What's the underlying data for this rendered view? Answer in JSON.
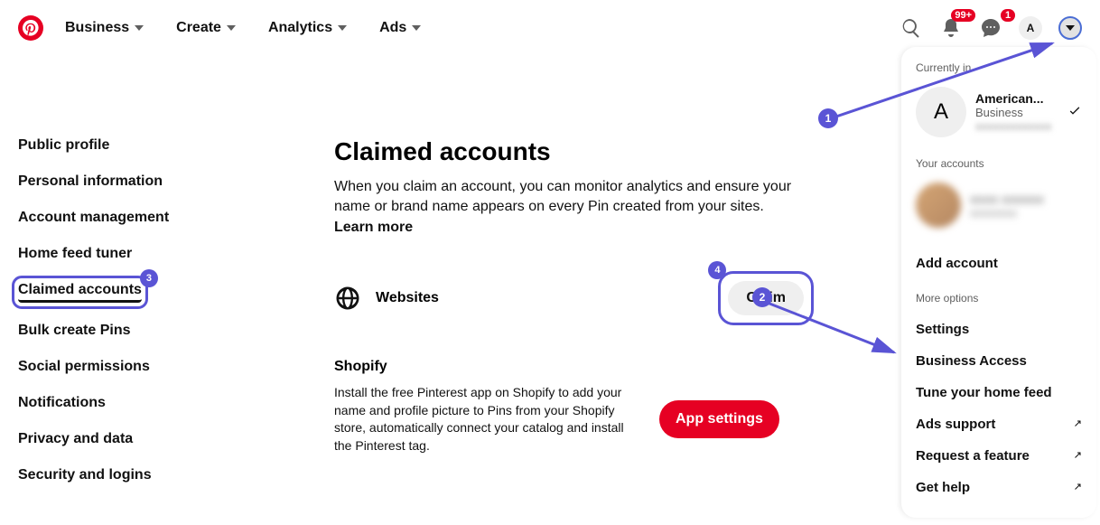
{
  "header": {
    "nav": [
      "Business",
      "Create",
      "Analytics",
      "Ads"
    ],
    "notif_badge": "99+",
    "msg_badge": "1",
    "avatar_letter": "A"
  },
  "sidebar": {
    "items": [
      "Public profile",
      "Personal information",
      "Account management",
      "Home feed tuner",
      "Claimed accounts",
      "Bulk create Pins",
      "Social permissions",
      "Notifications",
      "Privacy and data",
      "Security and logins"
    ]
  },
  "content": {
    "title": "Claimed accounts",
    "desc": "When you claim an account, you can monitor analytics and ensure your name or brand name appears on every Pin created from your sites. ",
    "learn_more": "Learn more",
    "websites_label": "Websites",
    "claim_button": "Claim",
    "shopify_title": "Shopify",
    "shopify_desc": "Install the free Pinterest app on Shopify to add your name and profile picture to Pins from your Shopify store, automatically connect your catalog and install the Pinterest tag.",
    "app_settings_button": "App settings"
  },
  "dropdown": {
    "currently_in": "Currently in",
    "account_name": "American...",
    "account_type": "Business",
    "account_hidden": "xxxxxxxxxxxxx",
    "your_accounts": "Your accounts",
    "hidden_name": "xxxx xxxxxx",
    "hidden_sub": "xxxxxxxx",
    "add_account": "Add account",
    "more_options": "More options",
    "items": [
      {
        "label": "Settings",
        "ext": false
      },
      {
        "label": "Business Access",
        "ext": false
      },
      {
        "label": "Tune your home feed",
        "ext": false
      },
      {
        "label": "Ads support",
        "ext": true
      },
      {
        "label": "Request a feature",
        "ext": true
      },
      {
        "label": "Get help",
        "ext": true
      }
    ]
  },
  "callouts": {
    "c1": "1",
    "c2": "2",
    "c3": "3",
    "c4": "4"
  }
}
